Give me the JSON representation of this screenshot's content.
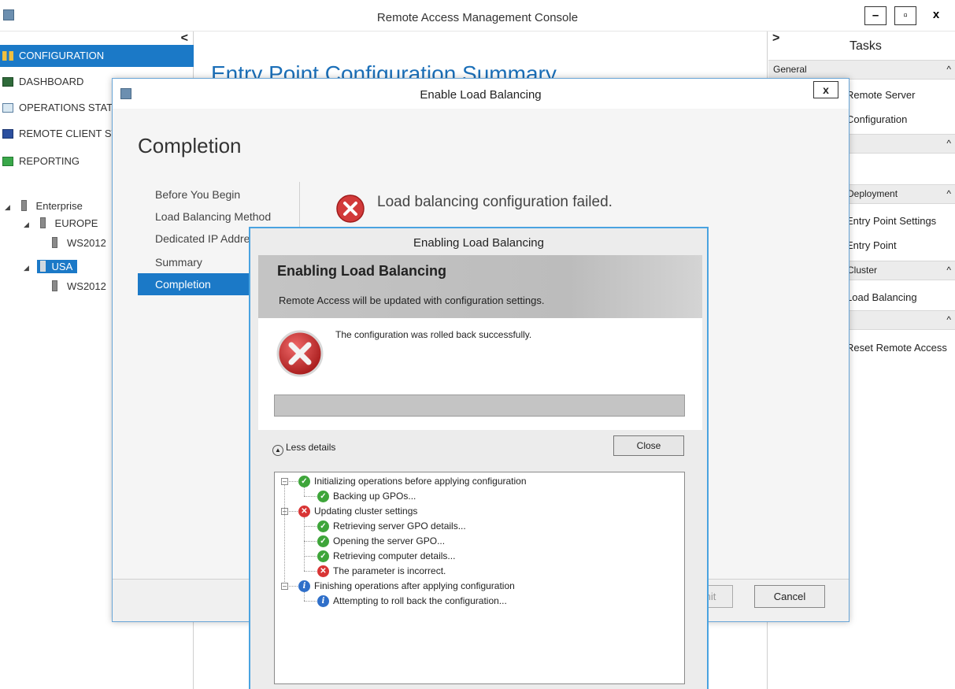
{
  "window": {
    "title": "Remote Access Management Console",
    "minimize": "–",
    "restore": "▫",
    "close": "x",
    "colors": {
      "accent": "#1b79c7",
      "heading": "#1b6fb8",
      "dialog_border": "#4aa3e0"
    }
  },
  "left_nav": {
    "collapse": "<",
    "items": [
      {
        "label": "CONFIGURATION",
        "icon": "tools-icon"
      },
      {
        "label": "DASHBOARD",
        "icon": "dashboard-icon"
      },
      {
        "label": "OPERATIONS STATUS",
        "icon": "operations-icon"
      },
      {
        "label": "REMOTE CLIENT STATUS",
        "icon": "monitor-icon"
      },
      {
        "label": "REPORTING",
        "icon": "report-icon"
      }
    ],
    "tree": {
      "root": "Enterprise",
      "children": [
        {
          "label": "EUROPE",
          "server": "WS2012"
        },
        {
          "label": "USA",
          "server": "WS2012"
        }
      ]
    }
  },
  "main": {
    "heading": "Entry Point Configuration Summary"
  },
  "right_panel": {
    "expand": ">",
    "title": "Tasks",
    "sections": [
      {
        "label": "General",
        "links": [
          "Remote Server",
          "Configuration"
        ]
      },
      {
        "label": "",
        "links": [
          ""
        ]
      },
      {
        "label": "Deployment",
        "links": [
          "Entry Point Settings",
          "Entry Point"
        ]
      },
      {
        "label": "Cluster",
        "links": [
          "Load Balancing"
        ]
      },
      {
        "label": "",
        "links": [
          "Reset Remote Access"
        ]
      }
    ]
  },
  "wizard": {
    "title": "Enable Load Balancing",
    "close": "x",
    "heading": "Completion",
    "steps": [
      "Before You Begin",
      "Load Balancing Method",
      "Dedicated IP Addresses",
      "Summary",
      "Completion"
    ],
    "result_message": "Load balancing configuration failed.",
    "commit_label": "Commit",
    "cancel_label": "Cancel"
  },
  "progress_dialog": {
    "title": "Enabling Load Balancing",
    "banner_heading": "Enabling Load Balancing",
    "banner_subtitle": "Remote Access will be updated with configuration settings.",
    "status_message": "The configuration was rolled back successfully.",
    "progress_fraction": 0,
    "toggle_label": "Less details",
    "close_label": "Close",
    "log": [
      {
        "level": 0,
        "status": "ok",
        "text": "Initializing operations before applying configuration"
      },
      {
        "level": 1,
        "status": "ok",
        "text": "Backing up GPOs..."
      },
      {
        "level": 0,
        "status": "err",
        "text": "Updating cluster settings"
      },
      {
        "level": 1,
        "status": "ok",
        "text": "Retrieving server GPO details..."
      },
      {
        "level": 1,
        "status": "ok",
        "text": "Opening the server GPO..."
      },
      {
        "level": 1,
        "status": "ok",
        "text": "Retrieving computer details..."
      },
      {
        "level": 1,
        "status": "err",
        "text": "The parameter is incorrect."
      },
      {
        "level": 0,
        "status": "info",
        "text": "Finishing operations after applying configuration"
      },
      {
        "level": 1,
        "status": "info",
        "text": "Attempting to roll back the configuration..."
      }
    ]
  }
}
